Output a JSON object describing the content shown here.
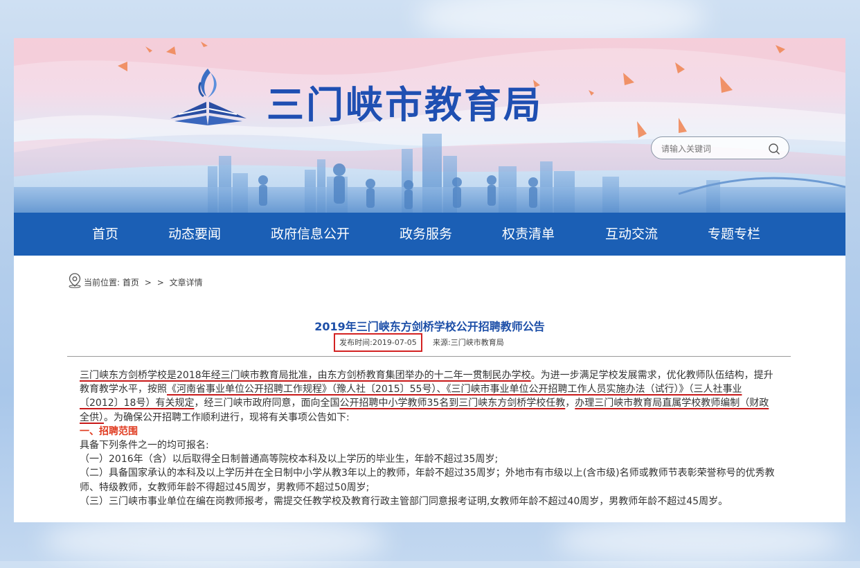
{
  "site": {
    "title": "三门峡市教育局",
    "search_placeholder": "请输入关键词"
  },
  "nav": {
    "items": [
      "首页",
      "动态要闻",
      "政府信息公开",
      "政务服务",
      "权责清单",
      "互动交流",
      "专题专栏"
    ]
  },
  "breadcrumb": {
    "prefix": "当前位置:",
    "home": "首页",
    "sep1": ">",
    "sep2": ">",
    "current": "文章详情"
  },
  "article": {
    "title": "2019年三门峡东方剑桥学校公开招聘教师公告",
    "date": "发布时间:2019-07-05",
    "source": "来源:三门峡市教育局",
    "p1_a": "三门峡东方剑桥学校是2018年经三门峡市教育局批准，由东方剑桥教育集团举办的十二年一贯制民办学校",
    "p1_b": "。为进一步满足学校发展需求，优化教师队伍结构，提升教育教学水平，按照",
    "p1_c": "《河南省事业单位公开招聘工作规程》（豫人社〔2015〕55号）、《三门峡市事业单位公开招聘工作人员实施办法（试行）》（三人社事业〔2012〕18号）有关规定",
    "p1_d": "，经三门峡市政府同意，面向全国",
    "p1_e": "公开招聘中小学教师35名到三门峡东方剑桥学校任教",
    "p1_f": "，",
    "p1_g": "办理三门峡市教育局直属学校教师编制（财政全供）",
    "p1_h": "。为确保公开招聘工作顺利进行，现将有关事项公告如下:",
    "section1": "一、招聘范围",
    "p2": "具备下列条件之一的均可报名:",
    "p3": "（一）2016年（含）以后取得全日制普通高等院校本科及以上学历的毕业生，年龄不超过35周岁;",
    "p4": "（二）具备国家承认的本科及以上学历并在全日制中小学从教3年以上的教师，年龄不超过35周岁；外地市有市级以上(含市级)名师或教师节表彰荣誉称号的优秀教师、特级教师，女教师年龄不得超过45周岁，男教师不超过50周岁;",
    "p5": "（三）三门峡市事业单位在编在岗教师报考，需提交任教学校及教育行政主管部门同意报考证明,女教师年龄不超过40周岁，男教师年龄不超过45周岁。"
  },
  "colors": {
    "nav_bg": "#1b5fb5",
    "title_blue": "#1f4fb2",
    "annotation_red": "#d32222",
    "section_red": "#e03b20"
  }
}
